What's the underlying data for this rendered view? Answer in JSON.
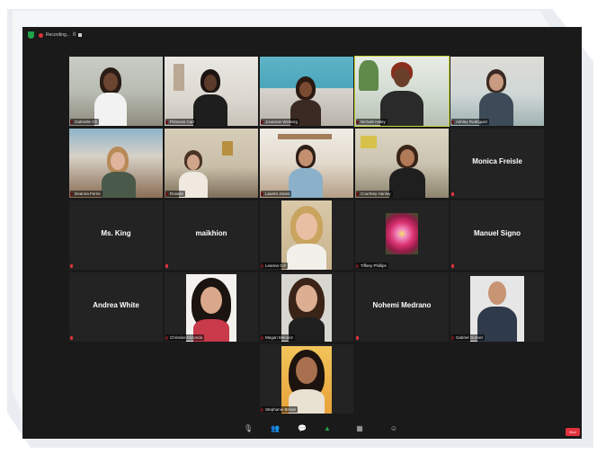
{
  "topbar": {
    "recording_label": "Recording...",
    "pause_symbol": "II",
    "shield_color": "#1fa24a",
    "record_color": "#e0323c"
  },
  "participants": [
    {
      "name": "Gabrielle Oli",
      "type": "video"
    },
    {
      "name": "Princess Carr",
      "type": "video"
    },
    {
      "name": "Jovannie Winberg",
      "type": "video"
    },
    {
      "name": "Nichole Haley",
      "type": "video",
      "speaking": true
    },
    {
      "name": "Ashley Rodriguez",
      "type": "video"
    },
    {
      "name": "Deanna Ferris",
      "type": "video"
    },
    {
      "name": "Rosalie",
      "type": "video"
    },
    {
      "name": "Lauren Jones",
      "type": "video"
    },
    {
      "name": "Courtney Hanley",
      "type": "video"
    },
    {
      "name": "Monica Freisle",
      "type": "name"
    },
    {
      "name": "Ms. King",
      "type": "name"
    },
    {
      "name": "maikhion",
      "type": "name"
    },
    {
      "name": "Leanne Gill",
      "type": "photo"
    },
    {
      "name": "Tiffany Phillips",
      "type": "photo"
    },
    {
      "name": "Manuel Signo",
      "type": "name"
    },
    {
      "name": "Andrea White",
      "type": "name"
    },
    {
      "name": "Christine Elizondo",
      "type": "photo"
    },
    {
      "name": "Megan Mendez",
      "type": "photo"
    },
    {
      "name": "Nohemi Medrano",
      "type": "name"
    },
    {
      "name": "Gabriel Gomez",
      "type": "photo"
    },
    {
      "name": "Stephanie Brown",
      "type": "photo"
    }
  ],
  "toolbar": {
    "end_label": "End",
    "end_color": "#e0323c"
  }
}
